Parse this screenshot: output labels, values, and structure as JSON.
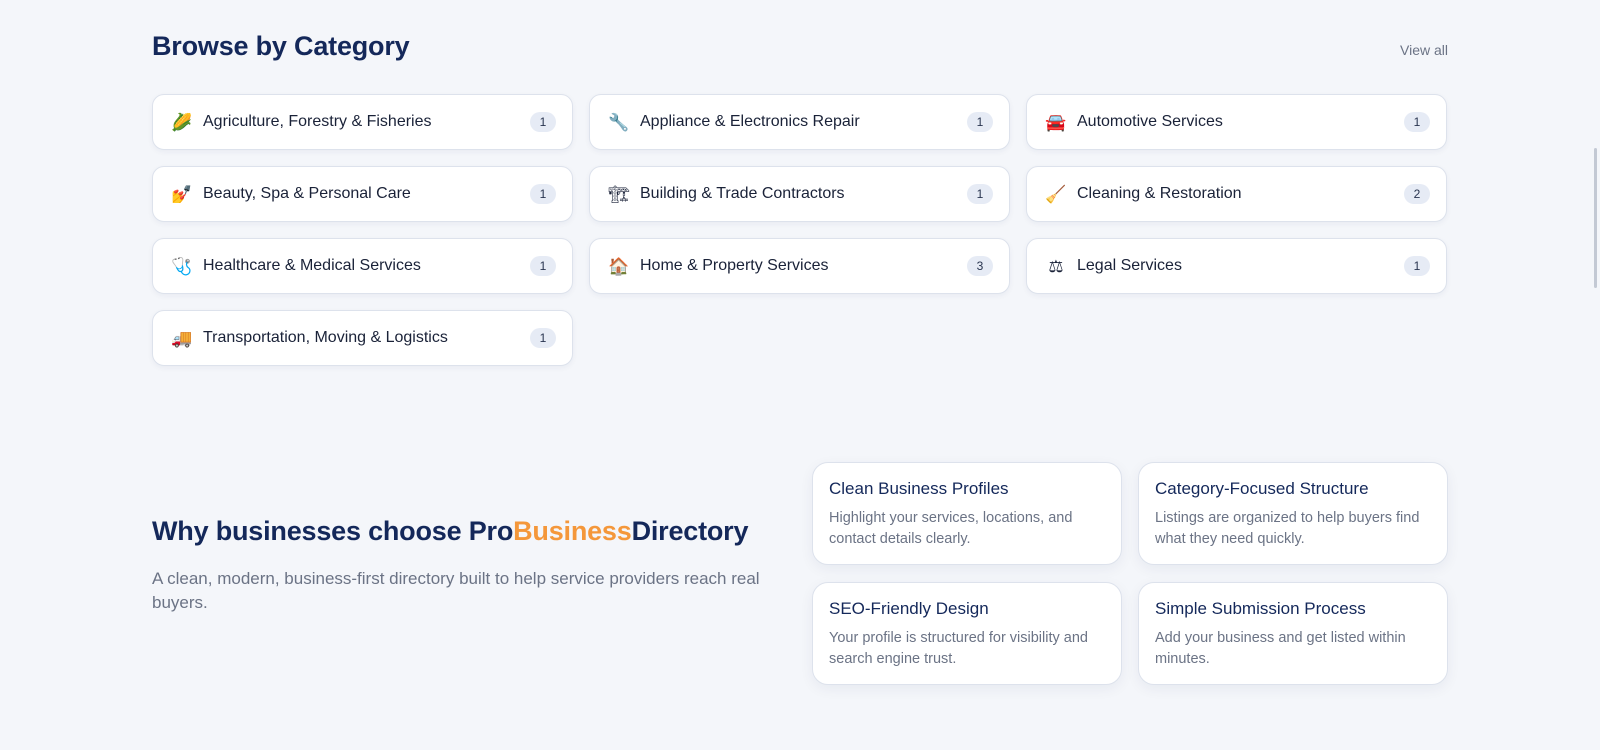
{
  "browse": {
    "title": "Browse by Category",
    "view_all": "View all",
    "categories": [
      {
        "label": "Agriculture, Forestry & Fisheries",
        "count": "1",
        "icon": "🌽",
        "icon_name": "corn-icon"
      },
      {
        "label": "Appliance & Electronics Repair",
        "count": "1",
        "icon": "🔧",
        "icon_name": "wrench-icon"
      },
      {
        "label": "Automotive Services",
        "count": "1",
        "icon": "🚘",
        "icon_name": "car-icon"
      },
      {
        "label": "Beauty, Spa & Personal Care",
        "count": "1",
        "icon": "💅",
        "icon_name": "nail-polish-icon"
      },
      {
        "label": "Building & Trade Contractors",
        "count": "1",
        "icon": "🏗",
        "icon_name": "construction-crane-icon"
      },
      {
        "label": "Cleaning & Restoration",
        "count": "2",
        "icon": "🧹",
        "icon_name": "broom-icon"
      },
      {
        "label": "Healthcare & Medical Services",
        "count": "1",
        "icon": "🩺",
        "icon_name": "stethoscope-icon"
      },
      {
        "label": "Home & Property Services",
        "count": "3",
        "icon": "🏠",
        "icon_name": "house-icon"
      },
      {
        "label": "Legal Services",
        "count": "1",
        "icon": "⚖",
        "icon_name": "scales-icon"
      },
      {
        "label": "Transportation, Moving & Logistics",
        "count": "1",
        "icon": "🚚",
        "icon_name": "truck-icon"
      }
    ]
  },
  "why": {
    "title_pre": "Why businesses choose Pro",
    "title_accent": "Business",
    "title_post": "Directory",
    "subtitle": "A clean, modern, business-first directory built to help service providers reach real buyers.",
    "features": [
      {
        "title": "Clean Business Profiles",
        "desc": "Highlight your services, locations, and contact details clearly."
      },
      {
        "title": "Category-Focused Structure",
        "desc": "Listings are organized to help buyers find what they need quickly."
      },
      {
        "title": "SEO-Friendly Design",
        "desc": "Your profile is structured for visibility and search engine trust."
      },
      {
        "title": "Simple Submission Process",
        "desc": "Add your business and get listed within minutes."
      }
    ]
  },
  "colors": {
    "heading": "#14285a",
    "accent": "#f4973a",
    "muted": "#6b7385",
    "background": "#f4f6fa"
  }
}
